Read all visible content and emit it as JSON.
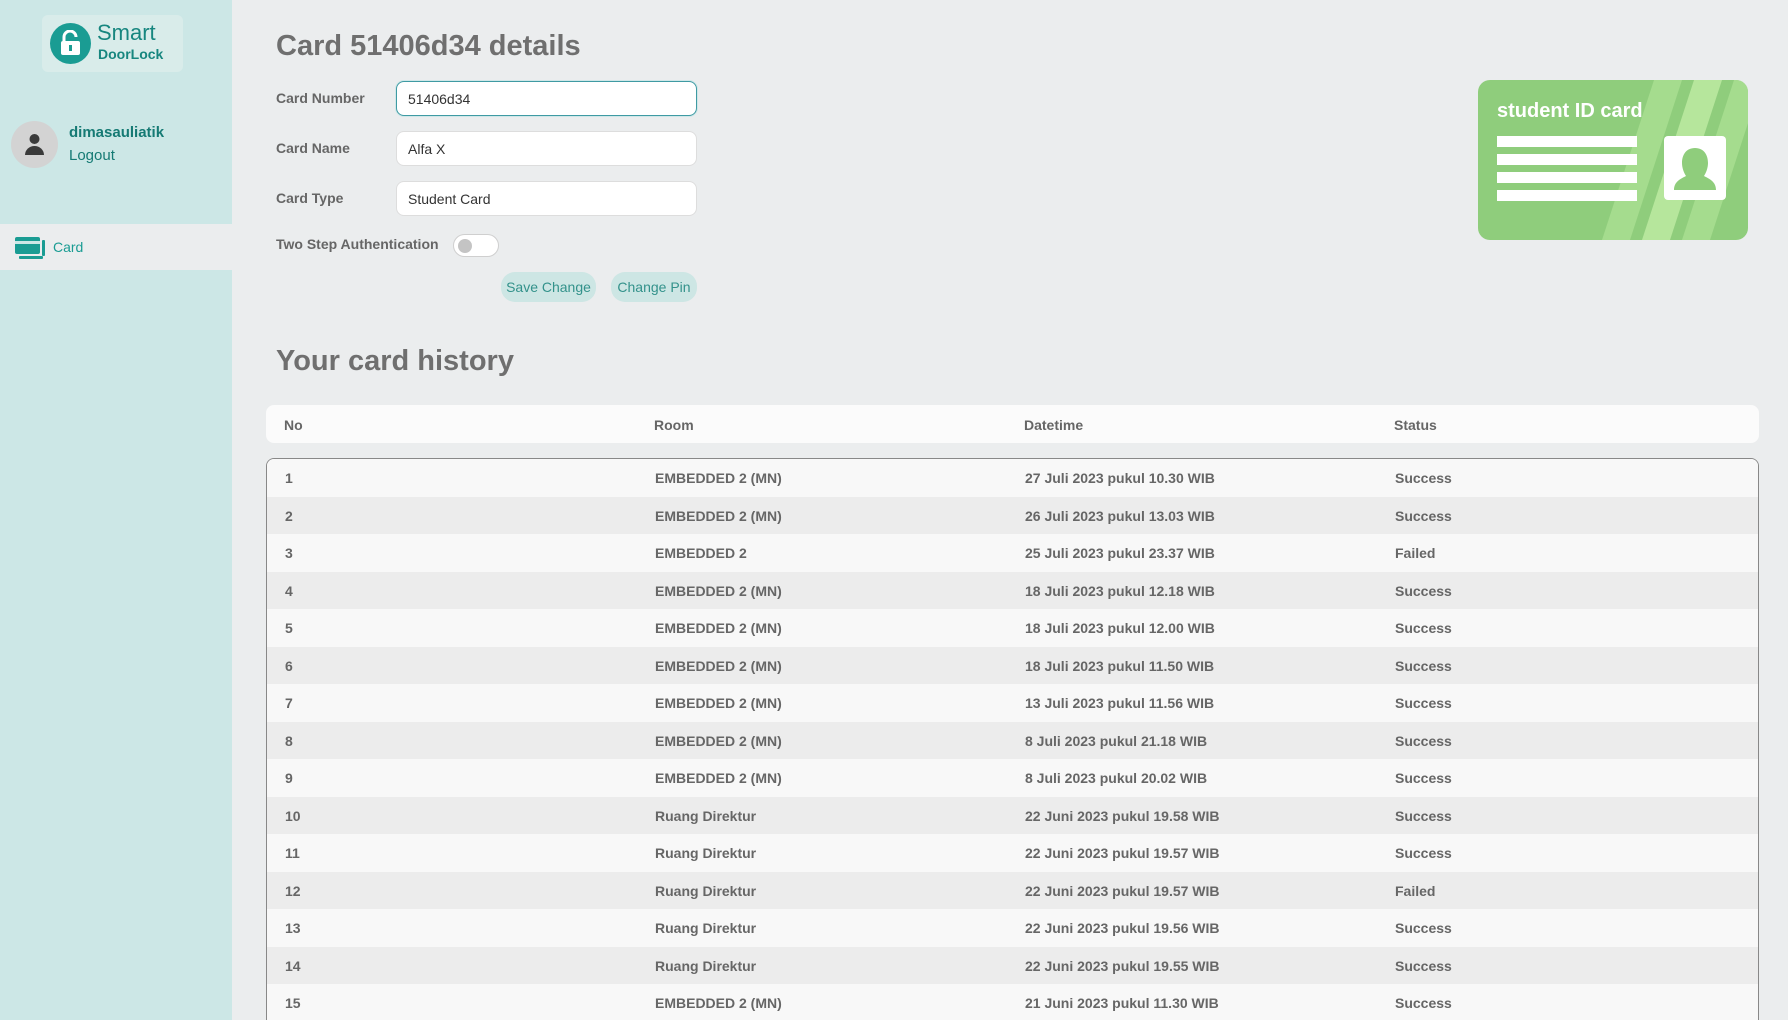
{
  "app": {
    "logo_line1": "Smart",
    "logo_line2": "DoorLock"
  },
  "user": {
    "username": "dimasauliatik",
    "logout_label": "Logout"
  },
  "sidebar": {
    "items": [
      {
        "label": "Card",
        "icon": "card-icon",
        "active": true
      }
    ]
  },
  "details": {
    "title": "Card 51406d34 details",
    "card_number_label": "Card Number",
    "card_number_value": "51406d34",
    "card_name_label": "Card Name",
    "card_name_value": "Alfa X",
    "card_type_label": "Card Type",
    "card_type_value": "Student Card",
    "two_step_label": "Two Step Authentication",
    "two_step_enabled": false,
    "save_label": "Save Change",
    "change_pin_label": "Change Pin"
  },
  "id_card": {
    "title": "student ID card",
    "color": "#8fcd7c"
  },
  "history": {
    "title": "Your card history",
    "columns": [
      "No",
      "Room",
      "Datetime",
      "Status"
    ],
    "rows": [
      {
        "no": "1",
        "room": "EMBEDDED 2 (MN)",
        "datetime": "27 Juli 2023 pukul 10.30 WIB",
        "status": "Success"
      },
      {
        "no": "2",
        "room": "EMBEDDED 2 (MN)",
        "datetime": "26 Juli 2023 pukul 13.03 WIB",
        "status": "Success"
      },
      {
        "no": "3",
        "room": "EMBEDDED 2",
        "datetime": "25 Juli 2023 pukul 23.37 WIB",
        "status": "Failed"
      },
      {
        "no": "4",
        "room": "EMBEDDED 2 (MN)",
        "datetime": "18 Juli 2023 pukul 12.18 WIB",
        "status": "Success"
      },
      {
        "no": "5",
        "room": "EMBEDDED 2 (MN)",
        "datetime": "18 Juli 2023 pukul 12.00 WIB",
        "status": "Success"
      },
      {
        "no": "6",
        "room": "EMBEDDED 2 (MN)",
        "datetime": "18 Juli 2023 pukul 11.50 WIB",
        "status": "Success"
      },
      {
        "no": "7",
        "room": "EMBEDDED 2 (MN)",
        "datetime": "13 Juli 2023 pukul 11.56 WIB",
        "status": "Success"
      },
      {
        "no": "8",
        "room": "EMBEDDED 2 (MN)",
        "datetime": "8 Juli 2023 pukul 21.18 WIB",
        "status": "Success"
      },
      {
        "no": "9",
        "room": "EMBEDDED 2 (MN)",
        "datetime": "8 Juli 2023 pukul 20.02 WIB",
        "status": "Success"
      },
      {
        "no": "10",
        "room": "Ruang Direktur",
        "datetime": "22 Juni 2023 pukul 19.58 WIB",
        "status": "Success"
      },
      {
        "no": "11",
        "room": "Ruang Direktur",
        "datetime": "22 Juni 2023 pukul 19.57 WIB",
        "status": "Success"
      },
      {
        "no": "12",
        "room": "Ruang Direktur",
        "datetime": "22 Juni 2023 pukul 19.57 WIB",
        "status": "Failed"
      },
      {
        "no": "13",
        "room": "Ruang Direktur",
        "datetime": "22 Juni 2023 pukul 19.56 WIB",
        "status": "Success"
      },
      {
        "no": "14",
        "room": "Ruang Direktur",
        "datetime": "22 Juni 2023 pukul 19.55 WIB",
        "status": "Success"
      },
      {
        "no": "15",
        "room": "EMBEDDED 2 (MN)",
        "datetime": "21 Juni 2023 pukul 11.30 WIB",
        "status": "Success"
      }
    ]
  },
  "colors": {
    "accent": "#1a9c93",
    "sidebar_bg": "#cce7e6",
    "page_bg": "#ebedee"
  }
}
